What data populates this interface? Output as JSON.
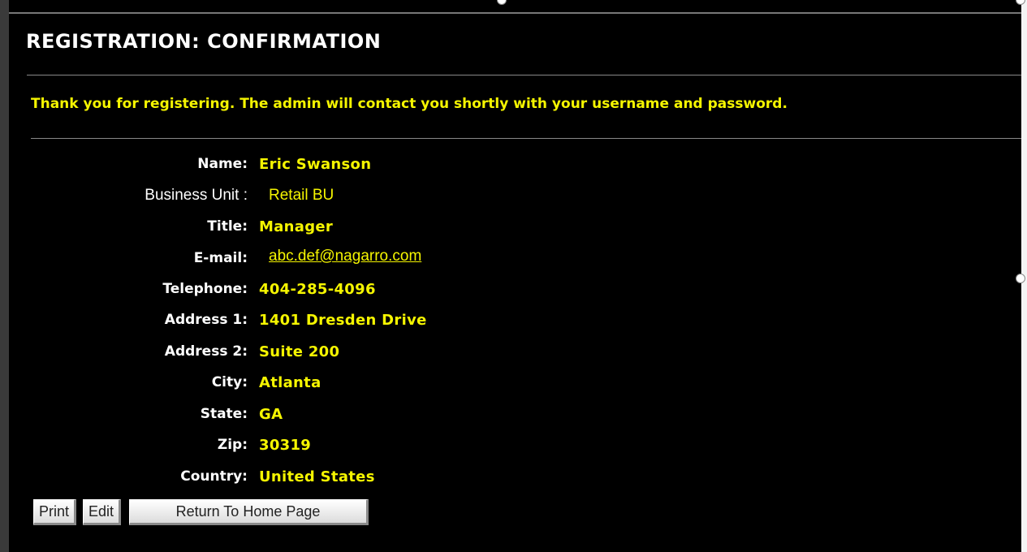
{
  "header": {
    "title": "REGISTRATION: CONFIRMATION",
    "message": "Thank you for registering. The admin will contact you shortly with your username and password."
  },
  "fields": [
    {
      "label": "Name:",
      "value": "Eric Swanson"
    },
    {
      "label": "Business Unit  :",
      "value": "Retail BU"
    },
    {
      "label": "Title:",
      "value": "Manager"
    },
    {
      "label": "E-mail:",
      "value": "abc.def@nagarro.com"
    },
    {
      "label": "Telephone:",
      "value": "404-285-4096"
    },
    {
      "label": "Address 1:",
      "value": "1401 Dresden Drive"
    },
    {
      "label": "Address 2:",
      "value": "Suite 200"
    },
    {
      "label": "City:",
      "value": "Atlanta"
    },
    {
      "label": "State:",
      "value": "GA"
    },
    {
      "label": "Zip:",
      "value": "30319"
    },
    {
      "label": "Country:",
      "value": "United States"
    }
  ],
  "buttons": {
    "print": "Print",
    "edit": "Edit",
    "home": "Return To Home Page"
  },
  "colors": {
    "background": "#000000",
    "label": "#ffffff",
    "value": "#f5f500"
  }
}
